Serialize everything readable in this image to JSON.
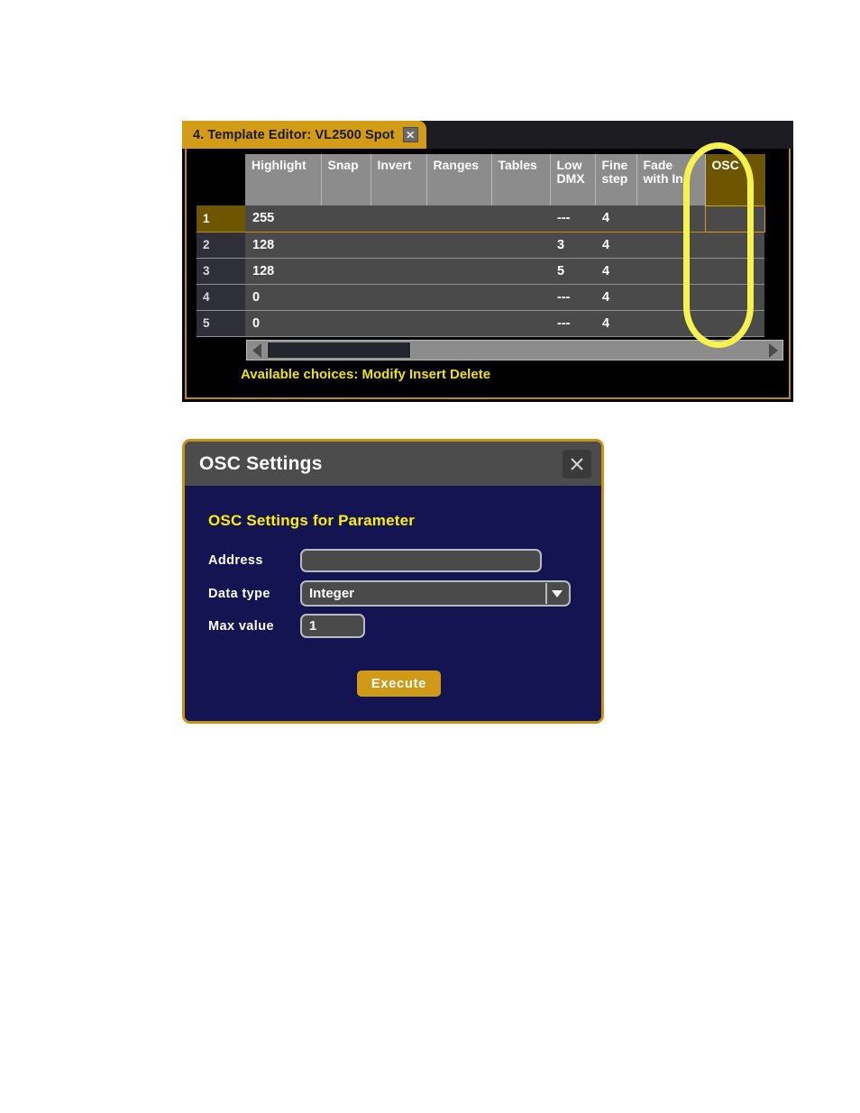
{
  "editor_window": {
    "tab_title": "4. Template Editor: VL2500 Spot",
    "close_icon": "close-icon",
    "table": {
      "columns": [
        "",
        "Highlight",
        "Snap",
        "Invert",
        "Ranges",
        "Tables",
        "Low DMX",
        "Fine step",
        "Fade with In",
        "OSC"
      ],
      "rows": [
        {
          "num": "1",
          "highlight": "255",
          "snap": "",
          "invert": "",
          "ranges": "",
          "tables": "",
          "low_dmx": "---",
          "fine_step": "4",
          "fade_with_in": "",
          "osc": "",
          "selected": true
        },
        {
          "num": "2",
          "highlight": "128",
          "snap": "",
          "invert": "",
          "ranges": "",
          "tables": "",
          "low_dmx": "3",
          "fine_step": "4",
          "fade_with_in": "",
          "osc": "",
          "selected": false
        },
        {
          "num": "3",
          "highlight": "128",
          "snap": "",
          "invert": "",
          "ranges": "",
          "tables": "",
          "low_dmx": "5",
          "fine_step": "4",
          "fade_with_in": "",
          "osc": "",
          "selected": false
        },
        {
          "num": "4",
          "highlight": "0",
          "snap": "",
          "invert": "",
          "ranges": "",
          "tables": "",
          "low_dmx": "---",
          "fine_step": "4",
          "fade_with_in": "",
          "osc": "",
          "selected": false
        },
        {
          "num": "5",
          "highlight": "0",
          "snap": "",
          "invert": "",
          "ranges": "",
          "tables": "",
          "low_dmx": "---",
          "fine_step": "4",
          "fade_with_in": "",
          "osc": "",
          "selected": false
        }
      ]
    },
    "status_line": "Available choices: Modify Insert Delete",
    "annotation": {
      "target_column": "OSC",
      "color": "#f7f24e"
    }
  },
  "osc_dialog": {
    "title": "OSC Settings",
    "close_icon": "close-icon",
    "section_title": "OSC Settings for Parameter",
    "fields": {
      "address": {
        "label": "Address",
        "value": ""
      },
      "data_type": {
        "label": "Data type",
        "value": "Integer"
      },
      "max_value": {
        "label": "Max value",
        "value": "1"
      }
    },
    "execute_label": "Execute",
    "colors": {
      "dialog_background": "#141452",
      "border": "#c89217",
      "section_title": "#fdf008",
      "button": "#cf9a18"
    }
  }
}
